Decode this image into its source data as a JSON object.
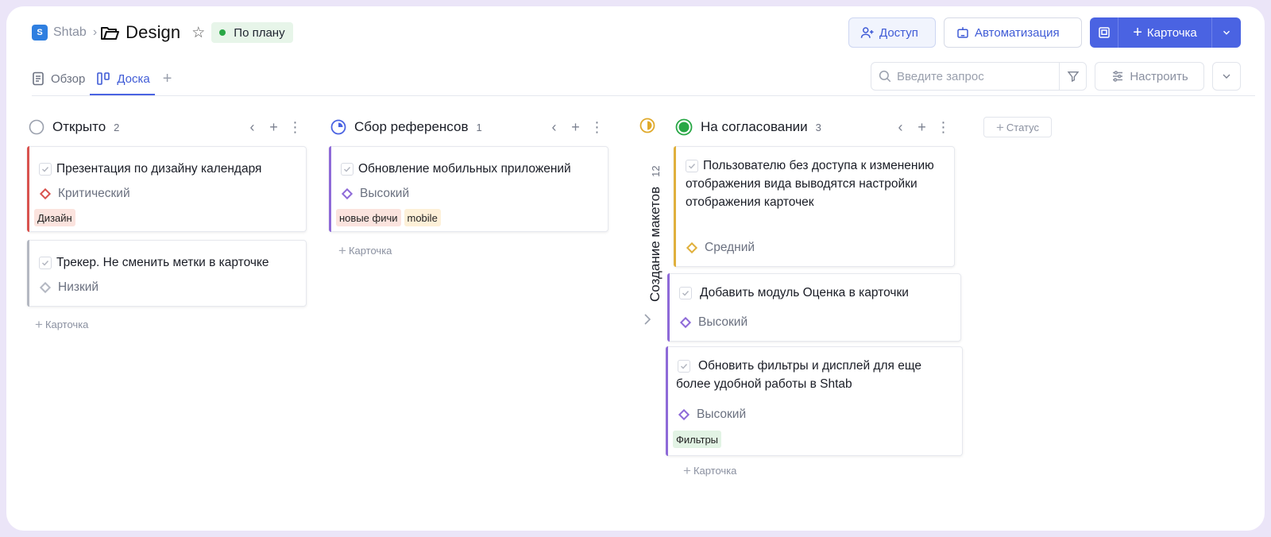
{
  "header": {
    "workspace": "Shtab",
    "logo_text": "S",
    "project_title": "Design",
    "status_label": "По плану",
    "access_label": "Доступ",
    "automation_label": "Автоматизация",
    "new_card_label": "Карточка"
  },
  "tabs": {
    "overview": "Обзор",
    "board": "Доска",
    "search_placeholder": "Введите запрос",
    "configure": "Настроить"
  },
  "columns": {
    "open": {
      "name": "Открыто",
      "count": "2",
      "cards": [
        {
          "title": "Презентация по дизайну календаря",
          "priority": "Критический",
          "tags": [
            "Дизайн"
          ]
        },
        {
          "title": "Трекер. Не сменить метки в карточке",
          "priority": "Низкий",
          "tags": []
        }
      ],
      "add_label": "Карточка"
    },
    "refs": {
      "name": "Сбор референсов",
      "count": "1",
      "cards": [
        {
          "title": "Обновление мобильных приложений",
          "priority": "Высокий",
          "tags": [
            "новые фичи",
            "mobile"
          ]
        }
      ],
      "add_label": "Карточка"
    },
    "mockups": {
      "name": "Создание макетов",
      "count": "12"
    },
    "review": {
      "name": "На согласовании",
      "count": "3",
      "cards": [
        {
          "title": "Пользователю без доступа к изменению отображения вида выводятся настройки отображения карточек",
          "priority": "Средний",
          "tags": []
        },
        {
          "title": "Добавить модуль Оценка в карточки",
          "priority": "Высокий",
          "tags": []
        },
        {
          "title": "Обновить фильтры и дисплей для еще более удобной работы в Shtab",
          "priority": "Высокий",
          "tags": [
            "Фильтры"
          ]
        }
      ],
      "add_label": "Карточка"
    }
  },
  "add_status_label": "Статус",
  "colors": {
    "accent": "#4a63e2",
    "critical": "#d9534f",
    "high": "#8e6ad8",
    "medium": "#e0b03c",
    "low": "#b4b8c2",
    "done_green": "#28a745"
  }
}
